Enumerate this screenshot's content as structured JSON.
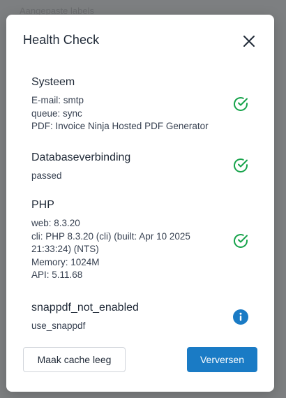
{
  "background": {
    "text_1": "Aangepaste labels"
  },
  "modal": {
    "title": "Health Check",
    "sections": [
      {
        "title": "Systeem",
        "lines": [
          "E-mail: smtp",
          "queue: sync",
          "PDF: Invoice Ninja Hosted PDF Generator"
        ],
        "status_icon": "check-circle-icon",
        "status_color": "#16a34a"
      },
      {
        "title": "Databaseverbinding",
        "lines": [
          "passed"
        ],
        "status_icon": "check-circle-icon",
        "status_color": "#16a34a"
      },
      {
        "title": "PHP",
        "lines": [
          "web: 8.3.20",
          "cli: PHP 8.3.20 (cli) (built: Apr 10 2025",
          "21:33:24) (NTS)",
          "Memory: 1024M",
          "API: 5.11.68"
        ],
        "status_icon": "check-circle-icon",
        "status_color": "#16a34a"
      },
      {
        "title": "snappdf_not_enabled",
        "lines": [
          "use_snappdf"
        ],
        "status_icon": "info-icon",
        "status_color": "#1a7bc5"
      }
    ],
    "buttons": {
      "clear_cache": "Maak cache leeg",
      "refresh": "Verversen"
    }
  }
}
